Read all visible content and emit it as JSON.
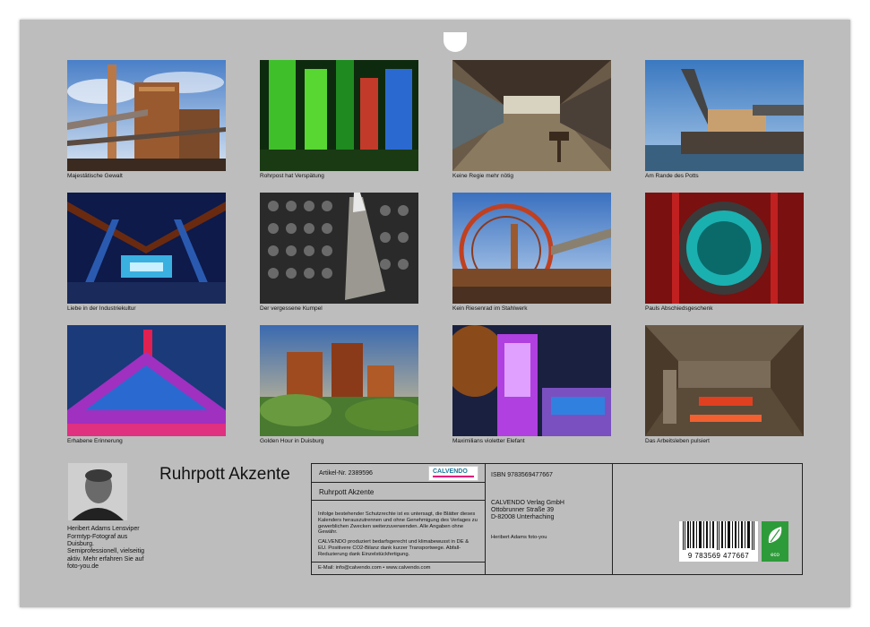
{
  "photos": [
    {
      "caption": "Majestätische Gewalt"
    },
    {
      "caption": "Rohrpost hat Verspätung"
    },
    {
      "caption": "Keine Regie mehr nötig"
    },
    {
      "caption": "Am Rande des Potts"
    },
    {
      "caption": "Liebe in der Industriekultur"
    },
    {
      "caption": "Der vergessene Kumpel"
    },
    {
      "caption": "Kein Riesenrad im Stahlwerk"
    },
    {
      "caption": "Pauls Abschiedsgeschenk"
    },
    {
      "caption": "Erhabene Erinnerung"
    },
    {
      "caption": "Golden Hour in Duisburg"
    },
    {
      "caption": "Maximilians violetter Elefant"
    },
    {
      "caption": "Das Arbeitsleben pulsiert"
    }
  ],
  "calendar_title": "Ruhrpott Akzente",
  "artist": {
    "name": "Heribert Adams Lensviper",
    "bio": "Formtyp-Fotograf aus Duisburg. Semiprofessionell, vielseitig aktiv. Mehr erfahren Sie auf foto-you.de"
  },
  "info": {
    "article_no": "Artikel-Nr. 2389596",
    "title_repeat": "Ruhrpott Akzente",
    "legal_1": "Infolge bestehender Schutzrechte ist es untersagt, die Blätter dieses Kalenders herauszutrennen und ohne Genehmigung des Verlages zu gewerblichen Zwecken weiterzuverwenden. Alle Angaben ohne Gewähr.",
    "legal_2": "CALVENDO produziert bedarfsgerecht und klimabewusst in DE & EU. Positivere CO2-Bilanz dank kurzer Transportwege. Abfall-Reduzierung dank Einzelstückfertigung.",
    "contact": "E-Mail: info@calvendo.com • www.calvendo.com",
    "isbn": "ISBN 9783569477667",
    "publisher_name": "CALVENDO Verlag GmbH",
    "publisher_street": "Ottobrunner Straße 39",
    "publisher_city": "D-82008 Unterhaching",
    "photographer_credit": "Heribert Adams foto-you",
    "barcode_number": "9 783569 477667",
    "logo_text": "CALVENDO",
    "eco_label": "eco"
  }
}
